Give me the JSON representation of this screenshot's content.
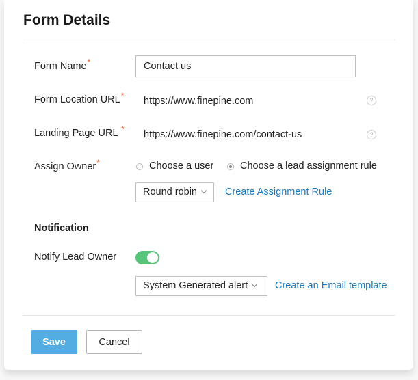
{
  "header": {
    "title": "Form Details"
  },
  "fields": {
    "form_name": {
      "label": "Form Name",
      "required_mark": "*",
      "value": "Contact us"
    },
    "form_location_url": {
      "label": "Form Location URL",
      "required_mark": "*",
      "value": "https://www.finepine.com",
      "help_icon": "?"
    },
    "landing_page_url": {
      "label": "Landing Page URL",
      "required_mark": "*",
      "value": "https://www.finepine.com/contact-us",
      "help_icon": "?"
    },
    "assign_owner": {
      "label": "Assign Owner",
      "required_mark": "*",
      "options": [
        {
          "label": "Choose a user",
          "checked": false
        },
        {
          "label": "Choose a lead assignment rule",
          "checked": true
        }
      ],
      "rule_select": "Round robin",
      "create_link": "Create Assignment Rule"
    }
  },
  "notification": {
    "section_title": "Notification",
    "notify_label": "Notify Lead Owner",
    "notify_enabled": true,
    "template_select": "System Generated alert",
    "create_link": "Create an Email template"
  },
  "actions": {
    "save_label": "Save",
    "cancel_label": "Cancel"
  },
  "colors": {
    "accent": "#53ade2",
    "link": "#1a7bc0",
    "required": "#ef5a24",
    "toggle_on": "#58c47a"
  }
}
